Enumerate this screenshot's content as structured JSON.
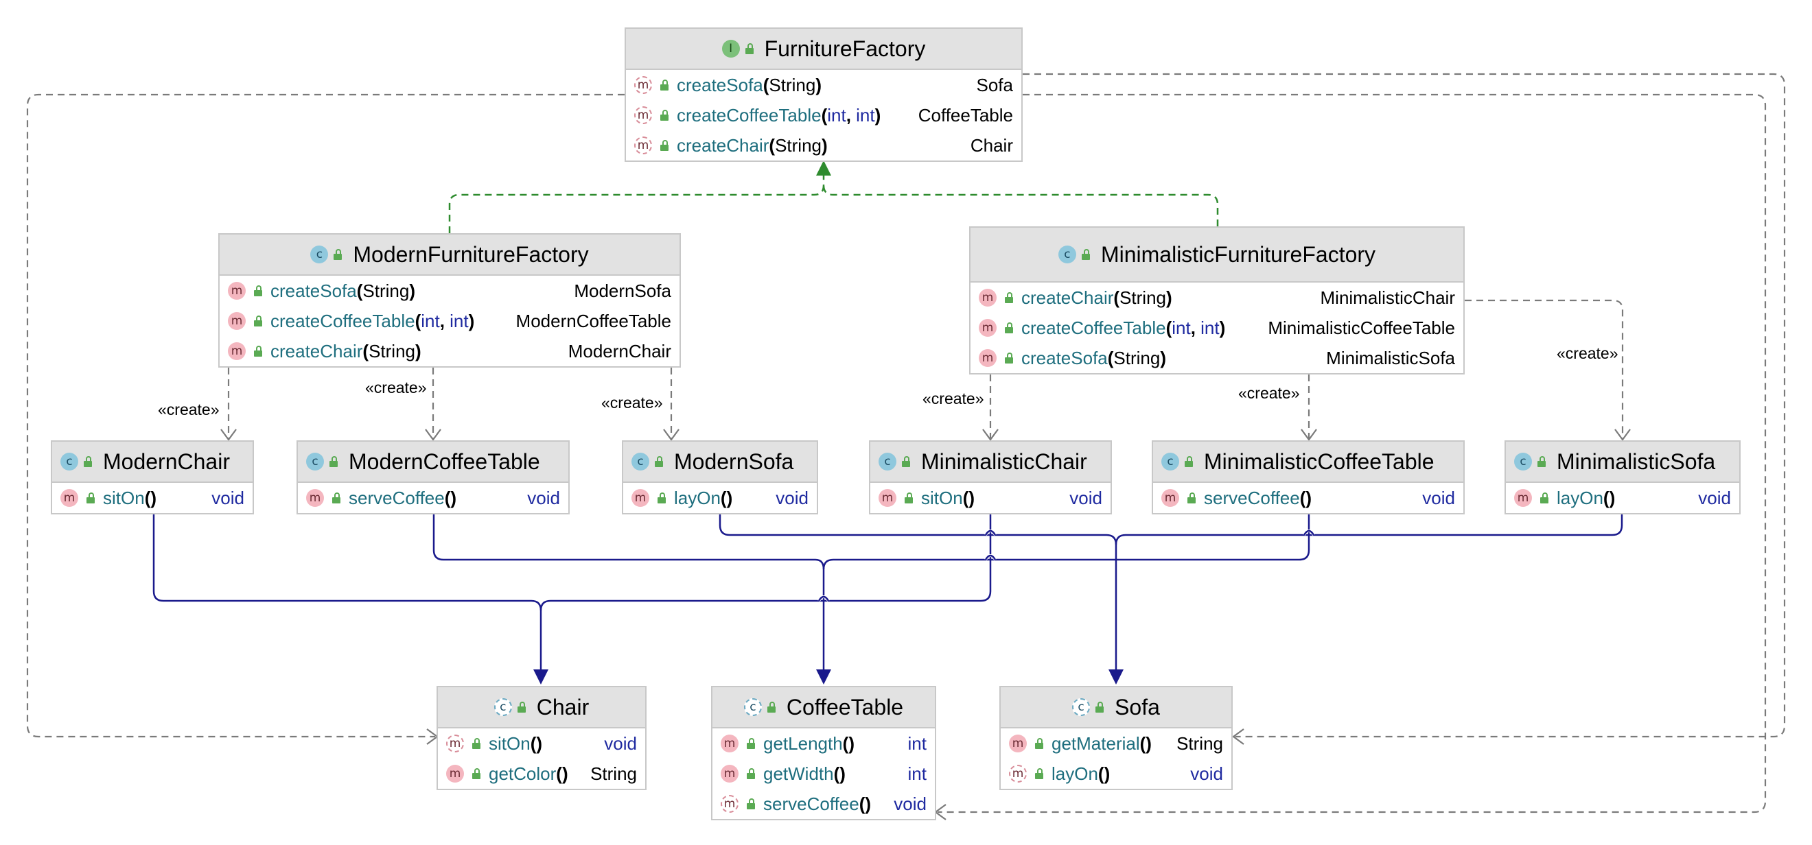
{
  "create_label": "«create»",
  "interface": {
    "name": "FurnitureFactory",
    "methods": [
      {
        "name": "createSofa",
        "p1": "String",
        "returns": "Sofa"
      },
      {
        "name": "createCoffeeTable",
        "p1": "int",
        "p2": "int",
        "returns": "CoffeeTable"
      },
      {
        "name": "createChair",
        "p1": "String",
        "returns": "Chair"
      }
    ]
  },
  "modern_factory": {
    "name": "ModernFurnitureFactory",
    "methods": [
      {
        "name": "createSofa",
        "p1": "String",
        "returns": "ModernSofa"
      },
      {
        "name": "createCoffeeTable",
        "p1": "int",
        "p2": "int",
        "returns": "ModernCoffeeTable"
      },
      {
        "name": "createChair",
        "p1": "String",
        "returns": "ModernChair"
      }
    ]
  },
  "minimalistic_factory": {
    "name": "MinimalisticFurnitureFactory",
    "methods": [
      {
        "name": "createChair",
        "p1": "String",
        "returns": "MinimalisticChair"
      },
      {
        "name": "createCoffeeTable",
        "p1": "int",
        "p2": "int",
        "returns": "MinimalisticCoffeeTable"
      },
      {
        "name": "createSofa",
        "p1": "String",
        "returns": "MinimalisticSofa"
      }
    ]
  },
  "products": {
    "modern_chair": {
      "name": "ModernChair",
      "method": "sitOn",
      "returns": "void"
    },
    "modern_coffee_table": {
      "name": "ModernCoffeeTable",
      "method": "serveCoffee",
      "returns": "void"
    },
    "modern_sofa": {
      "name": "ModernSofa",
      "method": "layOn",
      "returns": "void"
    },
    "minimalistic_chair": {
      "name": "MinimalisticChair",
      "method": "sitOn",
      "returns": "void"
    },
    "minimalistic_coffee_table": {
      "name": "MinimalisticCoffeeTable",
      "method": "serveCoffee",
      "returns": "void"
    },
    "minimalistic_sofa": {
      "name": "MinimalisticSofa",
      "method": "layOn",
      "returns": "void"
    }
  },
  "abstract": {
    "chair": {
      "name": "Chair",
      "methods": [
        {
          "name": "sitOn",
          "returns": "void"
        },
        {
          "name": "getColor",
          "returns": "String"
        }
      ]
    },
    "coffee_table": {
      "name": "CoffeeTable",
      "methods": [
        {
          "name": "getLength",
          "returns": "int"
        },
        {
          "name": "getWidth",
          "returns": "int"
        },
        {
          "name": "serveCoffee",
          "returns": "void"
        }
      ]
    },
    "sofa": {
      "name": "Sofa",
      "methods": [
        {
          "name": "getMaterial",
          "returns": "String"
        },
        {
          "name": "layOn",
          "returns": "void"
        }
      ]
    }
  },
  "colors": {
    "inheritance": "#1a1a8c",
    "realization": "#2e8b2e",
    "dependency": "#7a7a7a"
  }
}
